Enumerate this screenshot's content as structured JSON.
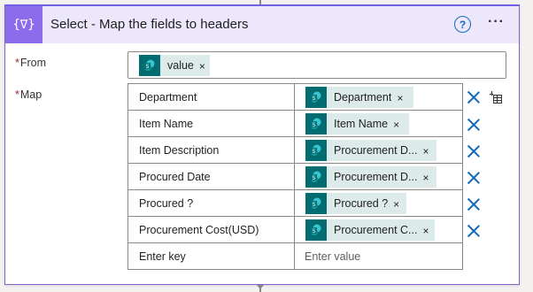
{
  "action": {
    "title": "Select - Map the fields to headers",
    "help_icon": "help-circle-icon",
    "more_icon": "more-ellipsis-icon",
    "header_icon": "data-operation-select-icon",
    "header_glyph": "{∇}",
    "help_glyph": "?",
    "more_glyph": "···"
  },
  "from": {
    "label": "From",
    "required_mark": "*",
    "token": {
      "label": "value",
      "remove": "×",
      "icon": "sharepoint-icon"
    }
  },
  "map": {
    "label": "Map",
    "required_mark": "*",
    "switch_icon": "switch-to-text-mode-icon",
    "rows": [
      {
        "key": "Department",
        "value": "Department",
        "remove": "×",
        "icon": "sharepoint-icon"
      },
      {
        "key": "Item Name",
        "value": "Item Name",
        "remove": "×",
        "icon": "sharepoint-icon"
      },
      {
        "key": "Item Description",
        "value": "Procurement D...",
        "remove": "×",
        "icon": "sharepoint-icon"
      },
      {
        "key": "Procured Date",
        "value": "Procurement D...",
        "remove": "×",
        "icon": "sharepoint-icon"
      },
      {
        "key": "Procured ?",
        "value": "Procured ?",
        "remove": "×",
        "icon": "sharepoint-icon"
      },
      {
        "key": "Procurement Cost(USD)",
        "value": "Procurement C...",
        "remove": "×",
        "icon": "sharepoint-icon"
      }
    ],
    "new_row": {
      "key_placeholder": "Enter key",
      "value_placeholder": "Enter value"
    }
  },
  "colors": {
    "accent": "#8c6cec",
    "header_bg": "#ece7fb",
    "token_bg": "#dcebe9",
    "sharepoint": "#036c70",
    "link_blue": "#0f6cbd"
  }
}
